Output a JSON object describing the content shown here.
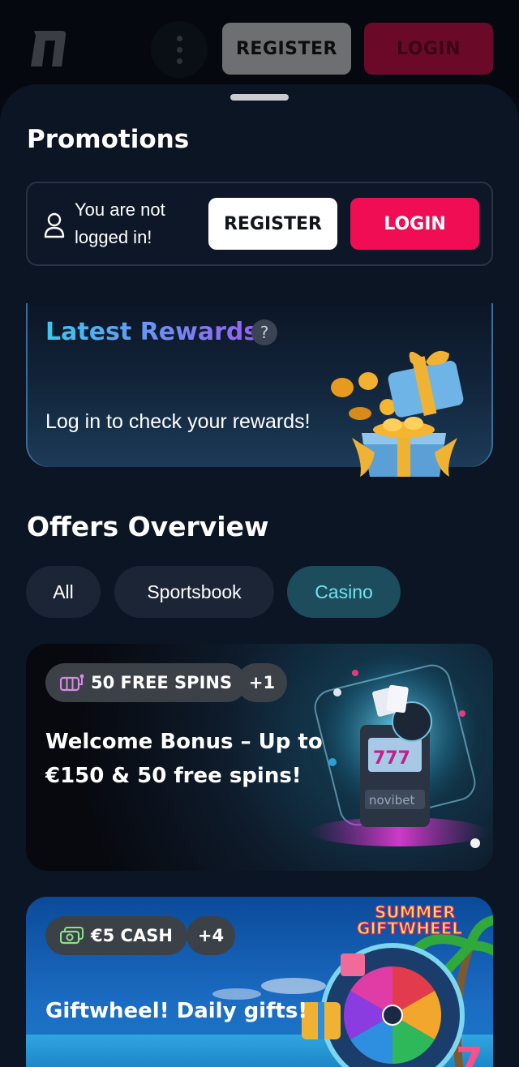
{
  "topbar": {
    "register_label": "REGISTER",
    "login_label": "LOGIN",
    "menu_icon": "kebab-menu-icon",
    "logo_icon": "brand-logo-n"
  },
  "page": {
    "title": "Promotions"
  },
  "auth": {
    "message": "You are not logged in!",
    "register_label": "REGISTER",
    "login_label": "LOGIN",
    "icon": "user-icon"
  },
  "rewards": {
    "title": "Latest Rewards",
    "help": "?",
    "message": "Log in to check your rewards!"
  },
  "offers": {
    "title": "Offers Overview",
    "filters": [
      {
        "label": "All",
        "active": false
      },
      {
        "label": "Sportsbook",
        "active": false
      },
      {
        "label": "Casino",
        "active": true
      }
    ],
    "cards": [
      {
        "badge_icon": "slot-machine-icon",
        "badge_label": "50 FREE SPINS",
        "extra": "+1",
        "title_line1": "Welcome Bonus – Up to",
        "title_line2": "€150 & 50 free spins!"
      },
      {
        "badge_icon": "cash-icon",
        "badge_label": "€5 CASH",
        "extra": "+4",
        "title_line1": "Giftwheel! Daily gifts!"
      }
    ]
  },
  "colors": {
    "background": "#0c1524",
    "login_pink": "#f00d54",
    "active_chip": "#1d4d5c",
    "active_chip_text": "#6fe3ef"
  }
}
